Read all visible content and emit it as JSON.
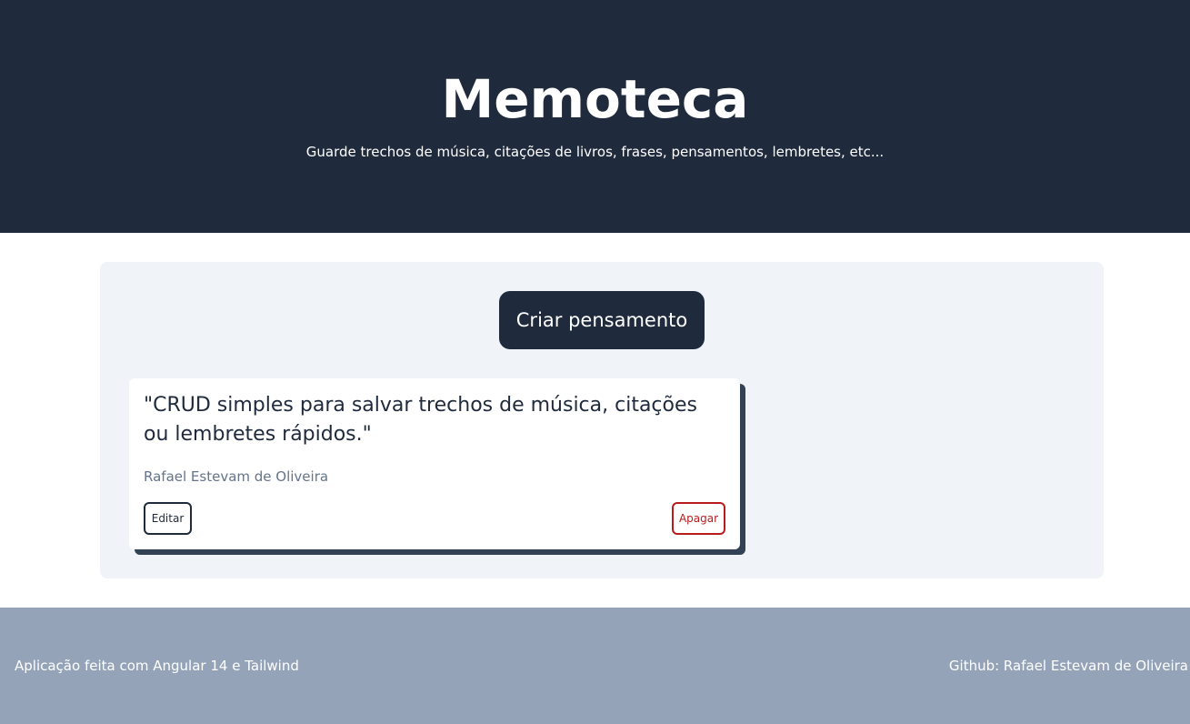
{
  "header": {
    "title": "Memoteca",
    "subtitle": "Guarde trechos de música, citações de livros, frases, pensamentos, lembretes, etc..."
  },
  "main": {
    "create_button_label": "Criar pensamento",
    "thoughts": [
      {
        "quote": "\"CRUD simples para salvar trechos de música, citações ou lembretes rápidos.\"",
        "author": "Rafael Estevam de Oliveira",
        "edit_label": "Editar",
        "delete_label": "Apagar"
      }
    ]
  },
  "footer": {
    "left_text": "Aplicação feita com Angular 14 e Tailwind",
    "right_text": "Github: Rafael Estevam de Oliveira"
  },
  "colors": {
    "header_bg": "#1f2a3d",
    "panel_bg": "#f0f3f8",
    "footer_bg": "#94a3b8",
    "delete_red": "#b91c1c"
  }
}
